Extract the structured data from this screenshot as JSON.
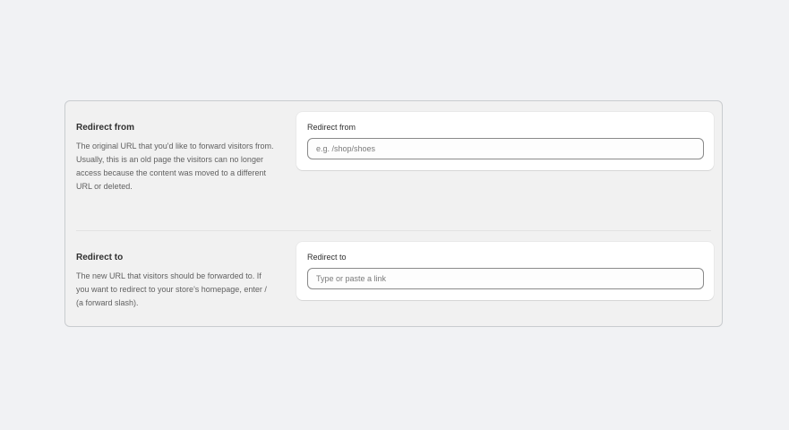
{
  "redirect_from": {
    "heading": "Redirect from",
    "description": "The original URL that you'd like to forward visitors from. Usually, this is an old page the visitors can no longer access because the content was moved to a different URL or deleted.",
    "field_label": "Redirect from",
    "input_value": "",
    "input_placeholder": "e.g. /shop/shoes"
  },
  "redirect_to": {
    "heading": "Redirect to",
    "description": "The new URL that visitors should be forwarded to. If you want to redirect to your store's homepage, enter / (a forward slash).",
    "field_label": "Redirect to",
    "input_value": "",
    "input_placeholder": "Type or paste a link"
  }
}
